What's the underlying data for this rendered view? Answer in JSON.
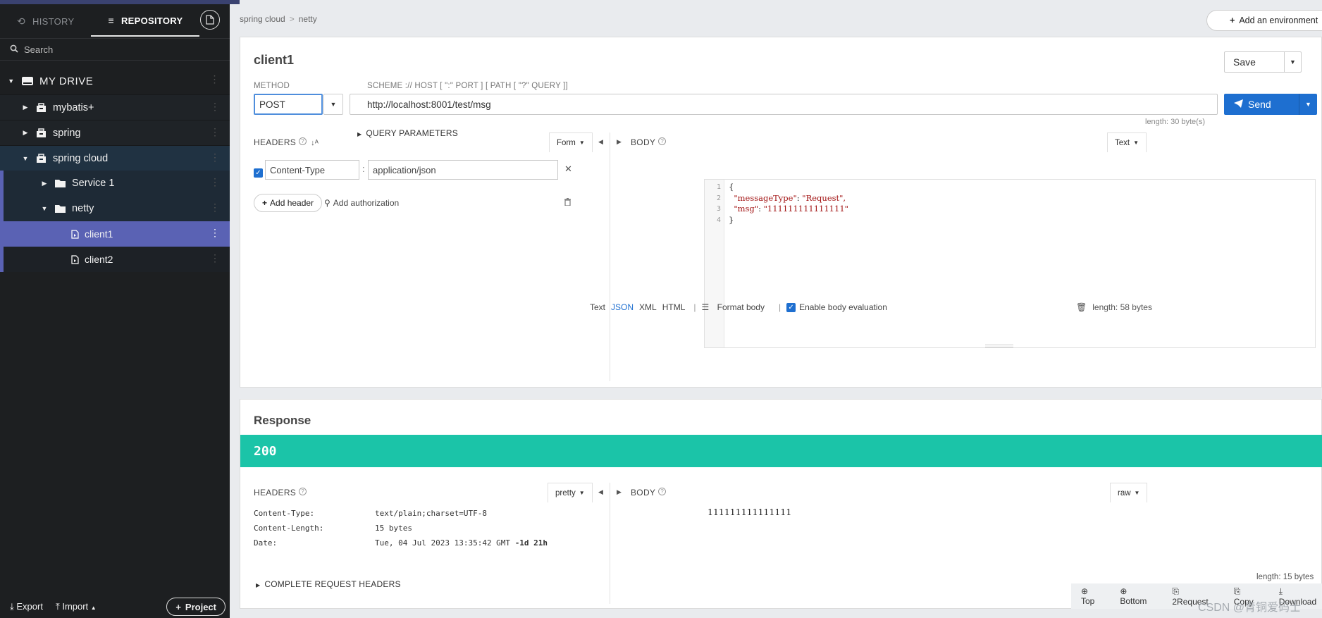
{
  "sidebar": {
    "tabs": [
      {
        "label": "HISTORY",
        "icon": "history-icon"
      },
      {
        "label": "REPOSITORY",
        "icon": "database-icon"
      }
    ],
    "search_placeholder": "Search",
    "drive": {
      "label": "MY DRIVE"
    },
    "items": [
      {
        "label": "mybatis+",
        "type": "project"
      },
      {
        "label": "spring",
        "type": "project"
      },
      {
        "label": "spring cloud",
        "type": "project",
        "open": true
      },
      {
        "label": "Service 1",
        "type": "folder"
      },
      {
        "label": "netty",
        "type": "folder",
        "open": true
      },
      {
        "label": "client1",
        "type": "request",
        "selected": true
      },
      {
        "label": "client2",
        "type": "request"
      }
    ],
    "footer": {
      "export": "Export",
      "import": "Import",
      "project": "Project"
    }
  },
  "breadcrumb": [
    "spring cloud",
    "netty"
  ],
  "add_environment": "Add an environment",
  "request": {
    "title": "client1",
    "save_label": "Save",
    "method_label": "METHOD",
    "method": "POST",
    "url_label": "SCHEME :// HOST [ \":\" PORT ] [ PATH [ \"?\" QUERY ]]",
    "url": "http://localhost:8001/test/msg",
    "url_length": "length: 30 byte(s)",
    "send_label": "Send",
    "query_params": "QUERY PARAMETERS",
    "headers": {
      "title": "HEADERS",
      "mode": "Form",
      "rows": [
        {
          "name": "Content-Type",
          "value": "application/json",
          "enabled": true
        }
      ],
      "add_header": "Add header",
      "add_authorization": "Add authorization"
    },
    "body": {
      "title": "BODY",
      "mode": "Text",
      "line_numbers": [
        "1",
        "2",
        "3",
        "4"
      ],
      "lines": [
        {
          "key": "",
          "val": "{"
        },
        {
          "key": "\"messageType\"",
          "val": "\"Request\","
        },
        {
          "key": "\"msg\"",
          "val": "\"111111111111111\""
        },
        {
          "key": "",
          "val": "}"
        }
      ],
      "formats": [
        "Text",
        "JSON",
        "XML",
        "HTML"
      ],
      "active_format": "JSON",
      "format_body": "Format body",
      "enable_eval": "Enable body evaluation",
      "length": "length: 58 bytes"
    }
  },
  "response": {
    "title": "Response",
    "status": "200",
    "headers": {
      "title": "HEADERS",
      "mode": "pretty",
      "rows": [
        {
          "k": "Content-Type:",
          "v": "text/plain;charset=UTF-8"
        },
        {
          "k": "Content-Length:",
          "v": "15 bytes"
        },
        {
          "k": "Date:",
          "v": "Tue, 04 Jul 2023 13:35:42 GMT",
          "extra": "-1d 21h"
        }
      ]
    },
    "complete_headers": "COMPLETE REQUEST HEADERS",
    "body": {
      "title": "BODY",
      "mode": "raw",
      "text": "111111111111111",
      "length": "length: 15 bytes"
    },
    "actions": [
      "Top",
      "Bottom",
      "2Request",
      "Copy",
      "Download"
    ]
  },
  "watermark": "CSDN @青铜爱码士"
}
